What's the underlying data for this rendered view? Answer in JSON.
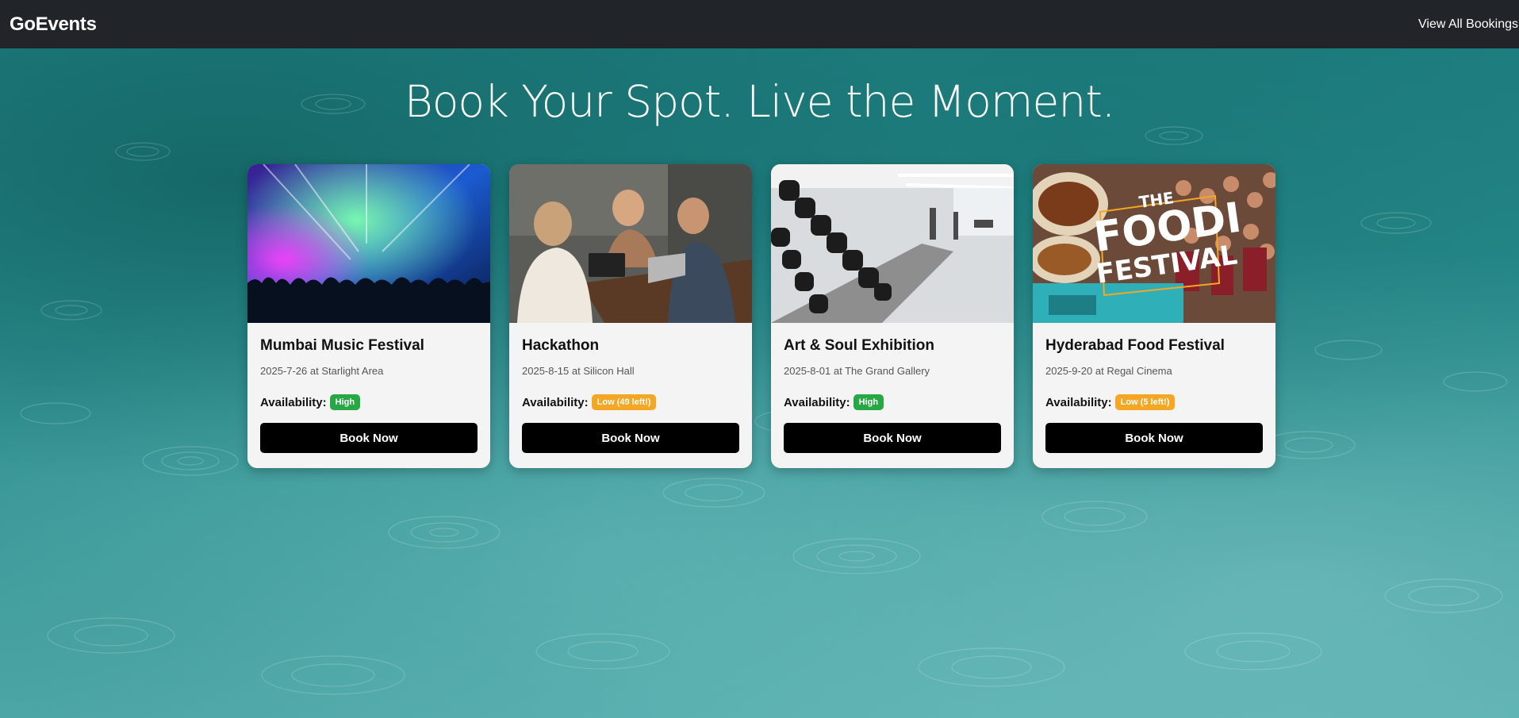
{
  "navbar": {
    "brand": "GoEvents",
    "link": "View All Bookings"
  },
  "hero": {
    "title": "Book Your Spot. Live the Moment."
  },
  "theme": {
    "navbar_bg": "#212529",
    "button_bg": "#000000",
    "badge_high": "#28a745",
    "badge_low": "#f5a623"
  },
  "events": [
    {
      "title": "Mumbai Music Festival",
      "meta": "2025-7-26 at Starlight Area",
      "availability_label": "Availability:",
      "availability": "High",
      "availability_level": "high",
      "button": "Book Now",
      "image": "concert-photo"
    },
    {
      "title": "Hackathon",
      "meta": "2025-8-15 at Silicon Hall",
      "availability_label": "Availability:",
      "availability": "Low (49 left!)",
      "availability_level": "low",
      "button": "Book Now",
      "image": "team-meeting-photo"
    },
    {
      "title": "Art & Soul Exhibition",
      "meta": "2025-8-01 at The Grand Gallery",
      "availability_label": "Availability:",
      "availability": "High",
      "availability_level": "high",
      "button": "Book Now",
      "image": "gym-dumbbells-photo"
    },
    {
      "title": "Hyderabad Food Festival",
      "meta": "2025-9-20 at Regal Cinema",
      "availability_label": "Availability:",
      "availability": "Low (5 left!)",
      "availability_level": "low",
      "button": "Book Now",
      "image": "food-festival-poster",
      "image_text": [
        "THE",
        "FOODI",
        "FESTIVAL"
      ]
    }
  ]
}
